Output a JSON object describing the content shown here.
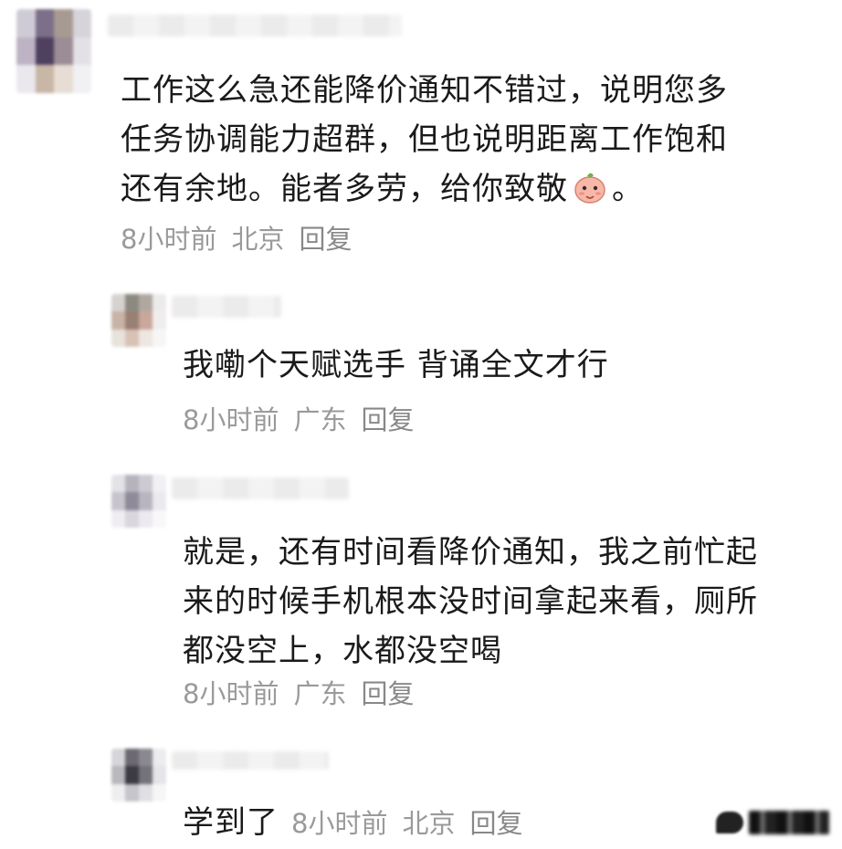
{
  "comments": [
    {
      "text_lines": [
        "工作这么急还能降价通知不错过，说明您多",
        "任务协调能力超群，但也说明距离工作饱和",
        "还有余地。能者多劳，给你致敬"
      ],
      "text_suffix": "。",
      "time": "8小时前",
      "location": "北京",
      "reply_label": "回复"
    },
    {
      "text_lines": [
        "我嘞个天赋选手  背诵全文才行"
      ],
      "time": "8小时前",
      "location": "广东",
      "reply_label": "回复"
    },
    {
      "text_lines": [
        "就是，还有时间看降价通知，我之前忙起",
        "来的时候手机根本没时间拿起来看，厕所",
        "都没空上，水都没空喝"
      ],
      "time": "8小时前",
      "location": "广东",
      "reply_label": "回复"
    },
    {
      "text": "学到了",
      "time": "8小时前",
      "location": "北京",
      "reply_label": "回复"
    }
  ]
}
